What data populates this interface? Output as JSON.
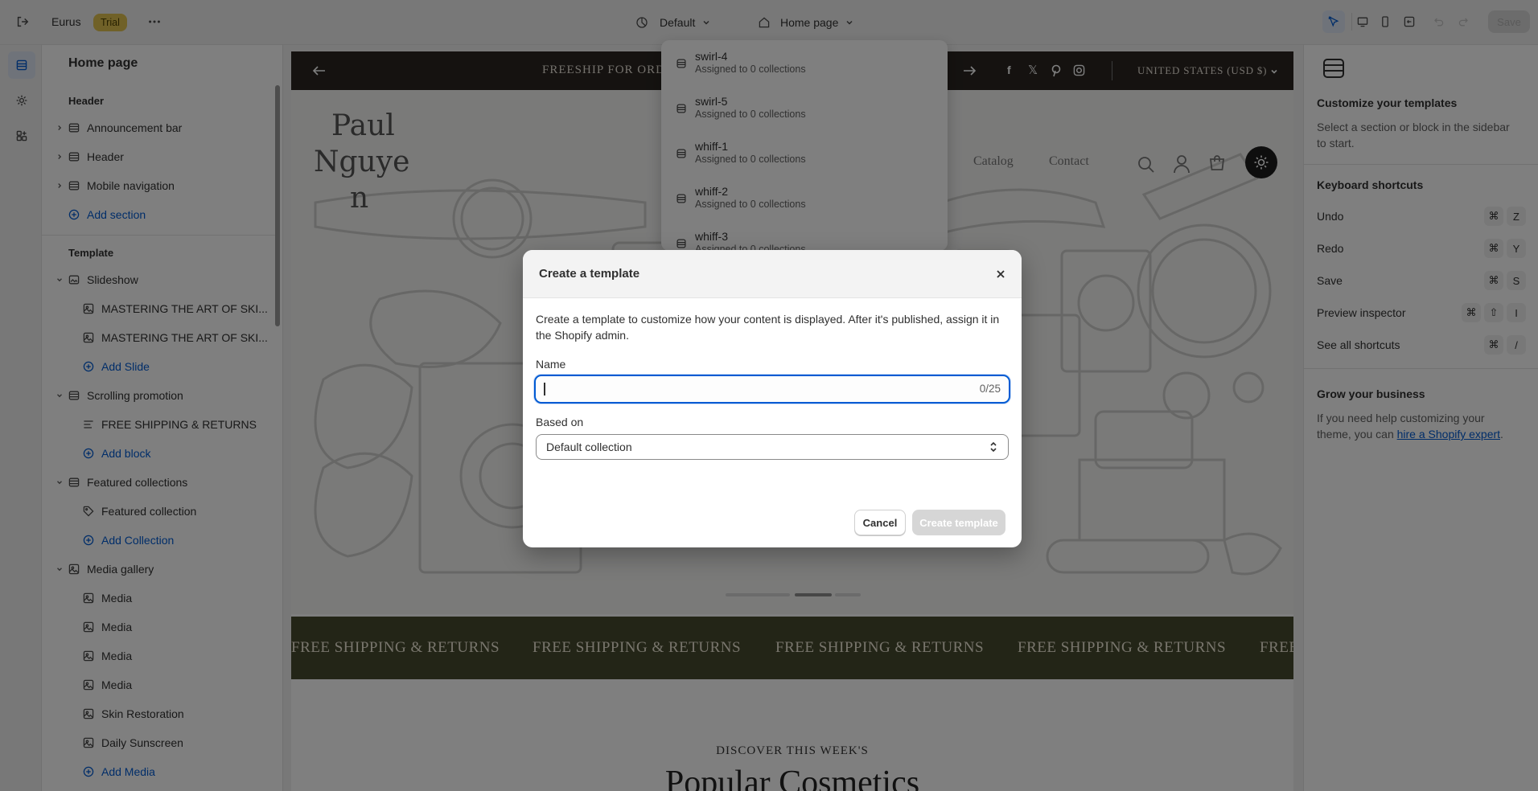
{
  "topbar": {
    "store_name": "Eurus",
    "badge": "Trial",
    "theme_label": "Default",
    "page_label": "Home page",
    "save_label": "Save"
  },
  "sidebar": {
    "title": "Home page",
    "header_section": "Header",
    "header_items": [
      "Announcement bar",
      "Header",
      "Mobile navigation"
    ],
    "add_section": "Add section",
    "template_section": "Template",
    "slideshow": "Slideshow",
    "slide_1": "MASTERING THE ART OF SKI...",
    "slide_2": "MASTERING THE ART OF SKI...",
    "add_slide": "Add Slide",
    "scrolling_promotion": "Scrolling promotion",
    "promo_block": "FREE SHIPPING & RETURNS",
    "add_block": "Add block",
    "featured_collections": "Featured collections",
    "featured_collection": "Featured collection",
    "add_collection": "Add Collection",
    "media_gallery": "Media gallery",
    "media_1": "Media",
    "media_2": "Media",
    "media_3": "Media",
    "media_4": "Media",
    "skin_restoration": "Skin Restoration",
    "daily_sunscreen": "Daily Sunscreen",
    "add_media": "Add Media"
  },
  "preview": {
    "announcement": "FREESHIP FOR ORDE",
    "currency": "UNITED STATES (USD $)",
    "logo_line1": "Paul",
    "logo_line2": "Nguye",
    "logo_line3": "n",
    "nav_catalog": "Catalog",
    "nav_contact": "Contact",
    "marquee": [
      "FREE SHIPPING & RETURNS",
      "FREE SHIPPING & RETURNS",
      "FREE SHIPPING & RETURNS",
      "FREE SHIPPING & RETURNS",
      "FREE"
    ],
    "kicker": "DISCOVER THIS WEEK'S",
    "heading": "Popular Cosmetics"
  },
  "dropdown": {
    "items": [
      {
        "name": "swirl-4",
        "sub": "Assigned to 0 collections"
      },
      {
        "name": "swirl-5",
        "sub": "Assigned to 0 collections"
      },
      {
        "name": "whiff-1",
        "sub": "Assigned to 0 collections"
      },
      {
        "name": "whiff-2",
        "sub": "Assigned to 0 collections"
      },
      {
        "name": "whiff-3",
        "sub": "Assigned to 0 collections"
      }
    ]
  },
  "right_panel": {
    "title": "Customize your templates",
    "desc": "Select a section or block in the sidebar to start.",
    "shortcuts_title": "Keyboard shortcuts",
    "shortcuts": [
      {
        "label": "Undo",
        "keys": [
          "⌘",
          "Z"
        ]
      },
      {
        "label": "Redo",
        "keys": [
          "⌘",
          "Y"
        ]
      },
      {
        "label": "Save",
        "keys": [
          "⌘",
          "S"
        ]
      },
      {
        "label": "Preview inspector",
        "keys": [
          "⌘",
          "⇧",
          "I"
        ]
      },
      {
        "label": "See all shortcuts",
        "keys": [
          "⌘",
          "/"
        ]
      }
    ],
    "grow_title": "Grow your business",
    "grow_text": "If you need help customizing your theme, you can ",
    "grow_link": "hire a Shopify expert",
    "grow_end": "."
  },
  "modal": {
    "title": "Create a template",
    "description": "Create a template to customize how your content is displayed. After it's published, assign it in the Shopify admin.",
    "name_label": "Name",
    "name_value": "",
    "name_counter": "0/25",
    "based_on_label": "Based on",
    "based_on_value": "Default collection",
    "cancel_label": "Cancel",
    "create_label": "Create template"
  },
  "colors": {
    "accent": "#005bd3",
    "promo_bg": "#464b2f",
    "announcement_bg": "#2a2521",
    "badge_bg": "#e1c250"
  }
}
